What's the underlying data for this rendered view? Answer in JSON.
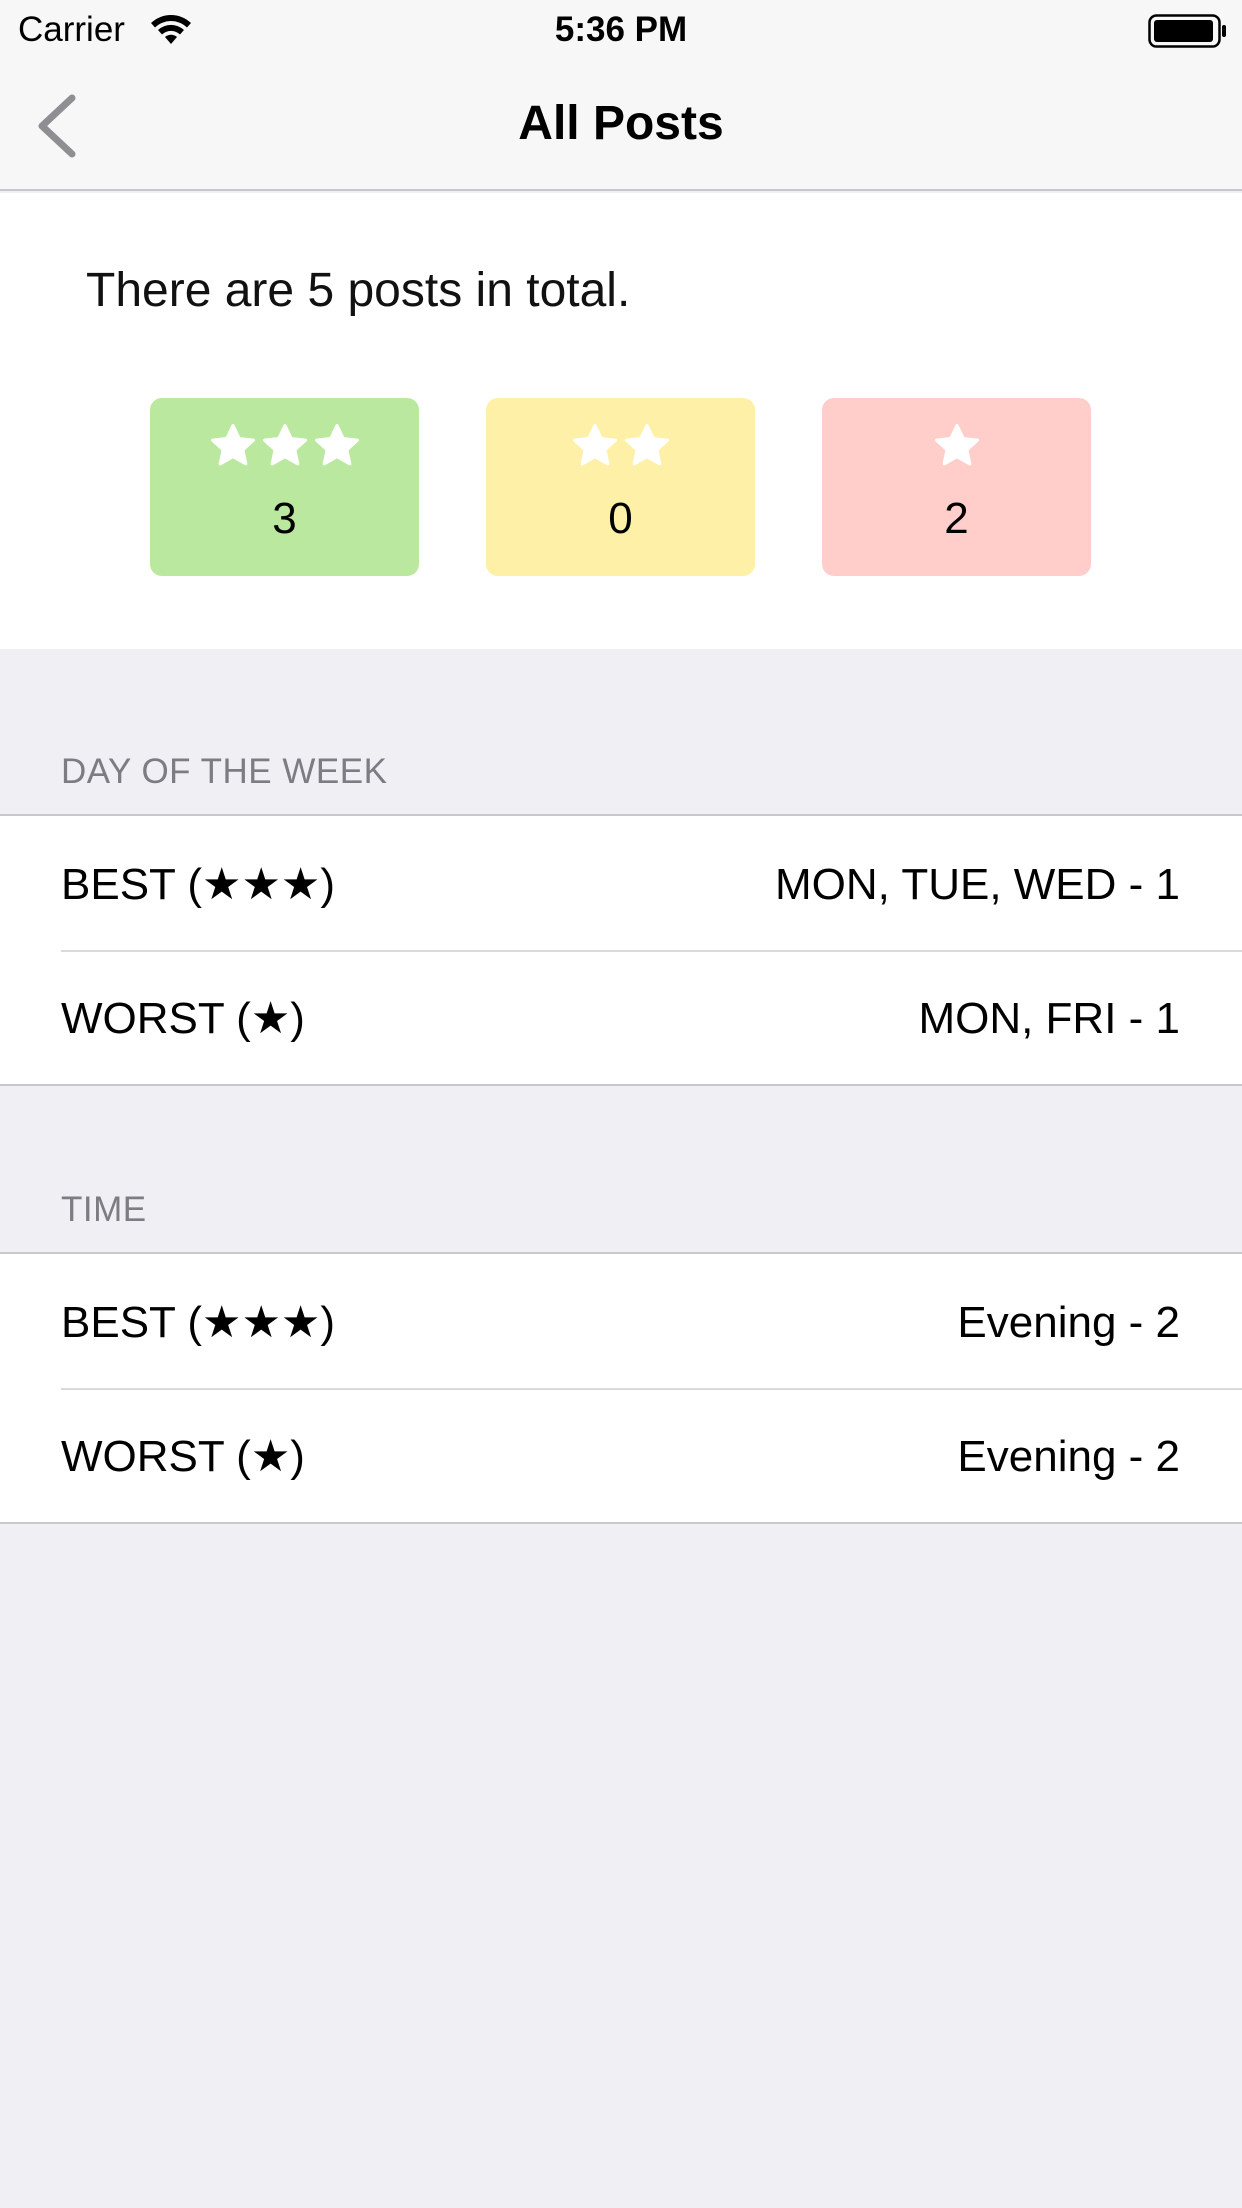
{
  "status_bar": {
    "carrier": "Carrier",
    "time": "5:36 PM",
    "wifi_icon": "wifi-icon",
    "battery_icon": "battery-icon"
  },
  "nav": {
    "title": "All Posts",
    "back_icon": "chevron-left-icon"
  },
  "summary": {
    "text": "There are 5 posts in total.",
    "tiles": [
      {
        "stars": 3,
        "count": "3",
        "color": "#B9E89E",
        "star_icon": "star-icon"
      },
      {
        "stars": 2,
        "count": "0",
        "color": "#FEF0A6",
        "star_icon": "star-icon"
      },
      {
        "stars": 1,
        "count": "2",
        "color": "#FFCECA",
        "star_icon": "star-icon"
      }
    ]
  },
  "sections": [
    {
      "header": "DAY OF THE WEEK",
      "rows": [
        {
          "label": "BEST (★★★)",
          "value": "MON, TUE, WED - 1"
        },
        {
          "label": "WORST (★)",
          "value": "MON, FRI - 1"
        }
      ]
    },
    {
      "header": "TIME",
      "rows": [
        {
          "label": "BEST (★★★)",
          "value": "Evening - 2"
        },
        {
          "label": "WORST (★)",
          "value": "Evening - 2"
        }
      ]
    }
  ],
  "colors": {
    "background": "#EFEFF4",
    "bar": "#F7F7F7",
    "separator": "#C8C7CC",
    "section_header": "#7C7C82"
  }
}
